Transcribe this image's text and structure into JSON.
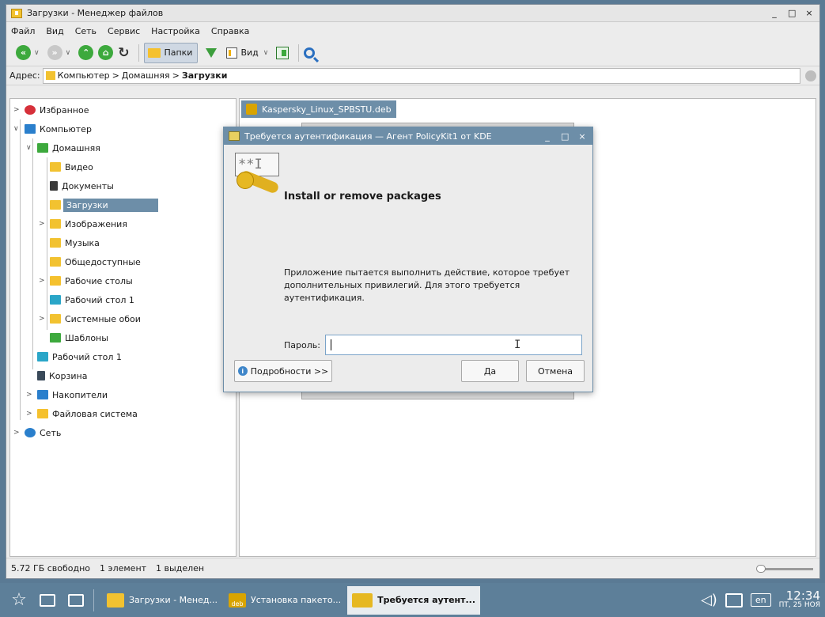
{
  "window": {
    "title": "Загрузки - Менеджер файлов",
    "controls": [
      "_",
      "□",
      "×"
    ]
  },
  "menu": [
    "Файл",
    "Вид",
    "Сеть",
    "Сервис",
    "Настройка",
    "Справка"
  ],
  "toolbar": {
    "folders_label": "Папки",
    "view_label": "Вид"
  },
  "address": {
    "label": "Адрес:",
    "crumbs": [
      "Компьютер",
      "Домашняя",
      "Загрузки"
    ],
    "separators": [
      ">",
      ">"
    ]
  },
  "tree": [
    {
      "label": "Избранное",
      "color": "#d6303a"
    },
    {
      "label": "Компьютер",
      "color": "#2a7fcc"
    },
    {
      "label": "Домашняя",
      "color": "#3da93d"
    },
    {
      "label": "Видео",
      "color": "#f2c230"
    },
    {
      "label": "Документы",
      "color": "#3a3a3a"
    },
    {
      "label": "Загрузки",
      "color": "#f2c230"
    },
    {
      "label": "Изображения",
      "color": "#f2c230"
    },
    {
      "label": "Музыка",
      "color": "#f2c230"
    },
    {
      "label": "Общедоступные",
      "color": "#f2c230"
    },
    {
      "label": "Рабочие столы",
      "color": "#f5c12e"
    },
    {
      "label": "Рабочий стол 1",
      "color": "#2aa6c8"
    },
    {
      "label": "Системные обои",
      "color": "#f2c230"
    },
    {
      "label": "Шаблоны",
      "color": "#3da93d"
    },
    {
      "label": "Рабочий стол 1",
      "color": "#2aa6c8"
    },
    {
      "label": "Корзина",
      "color": "#3a4a5a"
    },
    {
      "label": "Накопители",
      "color": "#2a7fcc"
    },
    {
      "label": "Файловая система",
      "color": "#f5c12e"
    },
    {
      "label": "Сеть",
      "color": "#2a7fcc"
    }
  ],
  "pane": {
    "file": "Kaspersky_Linux_SPBSTU.deb"
  },
  "status": {
    "free": "5.72 ГБ свободно",
    "count": "1 элемент",
    "selected": "1 выделен"
  },
  "dialog": {
    "title": "Требуется аутентификация — Агент PolicyKit1 от KDE",
    "controls": [
      "_",
      "□",
      "×"
    ],
    "key_card": "**I",
    "heading": "Install or remove packages",
    "message": "Приложение пытается выполнить действие, которое требует дополнительных привилегий. Для этого требуется аутентификация.",
    "password_label": "Пароль:",
    "password_value": "",
    "details_button": "Подробности >>",
    "ok_button": "Да",
    "cancel_button": "Отмена"
  },
  "taskbar": {
    "tasks": [
      "Загрузки - Менед...",
      "Установка пакето...",
      "Требуется аутент..."
    ],
    "deb_label": "deb",
    "lang": "en",
    "time": "12:34",
    "date": "ПТ, 25 НОЯ"
  }
}
